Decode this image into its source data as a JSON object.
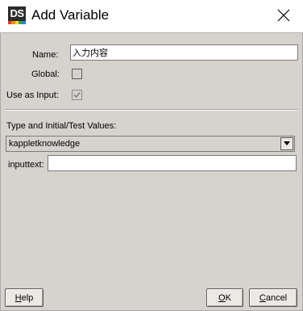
{
  "window": {
    "title": "Add Variable",
    "app_icon_text": "DS",
    "app_icon_stripe_colors": [
      "#e53935",
      "#fb8c00",
      "#fdd835",
      "#43a047",
      "#1e88e5"
    ]
  },
  "form": {
    "name_label": "Name:",
    "name_value": "入力内容",
    "global_label": "Global:",
    "global_checked": false,
    "use_as_input_label": "Use as Input:",
    "use_as_input_checked": true,
    "type_section_label": "Type and Initial/Test Values:",
    "type_selected": "kappletknowledge",
    "inputtext_label": "inputtext:",
    "inputtext_value": ""
  },
  "buttons": {
    "help": {
      "mnemonic": "H",
      "rest": "elp"
    },
    "ok": {
      "mnemonic": "O",
      "rest": "K"
    },
    "cancel": {
      "mnemonic": "C",
      "rest": "ancel"
    }
  },
  "colors": {
    "dialog_bg": "#d6d3ce",
    "titlebar_bg": "#ffffff"
  }
}
